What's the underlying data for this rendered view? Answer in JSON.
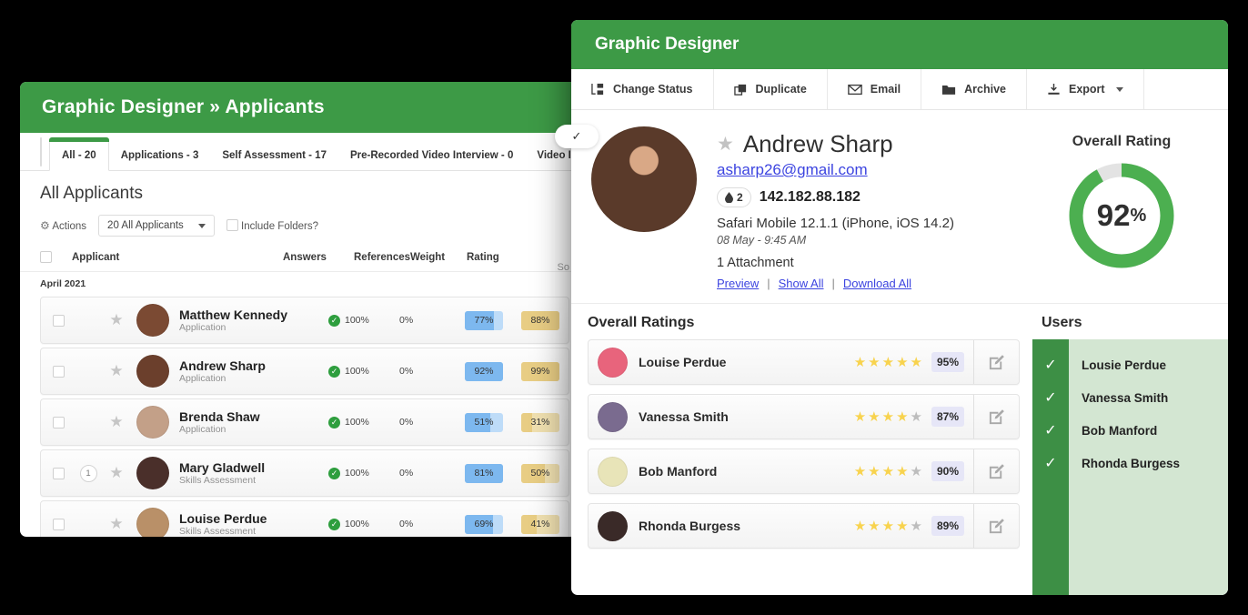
{
  "back_panel": {
    "header_title": "Graphic Designer » Applicants",
    "tabs": [
      {
        "label": "All - 20",
        "active": true
      },
      {
        "label": "Applications - 3",
        "active": false
      },
      {
        "label": "Self Assessment - 17",
        "active": false
      },
      {
        "label": "Pre-Recorded Video Interview - 0",
        "active": false
      },
      {
        "label": "Video Interview Complete",
        "active": false
      }
    ],
    "subtitle": "All Applicants",
    "sort_label": "So",
    "actions_label": "Actions",
    "filter_select": "20 All Applicants",
    "include_folders_label": "Include Folders?",
    "columns": [
      "Applicant",
      "Answers",
      "References",
      "Weight",
      "Rating"
    ],
    "month_group": "April 2021",
    "rows": [
      {
        "name": "Matthew Kennedy",
        "stage": "Application",
        "answers": "100%",
        "references": "0%",
        "weight": "77%",
        "weight_fill": 77,
        "rating": "88%",
        "rating_fill": 100,
        "count": "",
        "avatar": "#7b4a33"
      },
      {
        "name": "Andrew Sharp",
        "stage": "Application",
        "answers": "100%",
        "references": "0%",
        "weight": "92%",
        "weight_fill": 100,
        "rating": "99%",
        "rating_fill": 100,
        "count": "",
        "avatar": "#6b3f2c"
      },
      {
        "name": "Brenda Shaw",
        "stage": "Application",
        "answers": "100%",
        "references": "0%",
        "weight": "51%",
        "weight_fill": 66,
        "rating": "31%",
        "rating_fill": 28,
        "count": "",
        "avatar": "#c3a088"
      },
      {
        "name": "Mary Gladwell",
        "stage": "Skills Assessment",
        "answers": "100%",
        "references": "0%",
        "weight": "81%",
        "weight_fill": 100,
        "rating": "50%",
        "rating_fill": 62,
        "count": "1",
        "avatar": "#4a2f2a"
      },
      {
        "name": "Louise Perdue",
        "stage": "Skills Assessment",
        "answers": "100%",
        "references": "0%",
        "weight": "69%",
        "weight_fill": 73,
        "rating": "41%",
        "rating_fill": 40,
        "count": "",
        "avatar": "#b99068"
      }
    ]
  },
  "front_panel": {
    "header_title": "Graphic Designer",
    "toolbar": [
      {
        "label": "Change Status",
        "icon": "change-status-icon"
      },
      {
        "label": "Duplicate",
        "icon": "duplicate-icon"
      },
      {
        "label": "Email",
        "icon": "envelope-icon"
      },
      {
        "label": "Archive",
        "icon": "folder-icon"
      },
      {
        "label": "Export",
        "icon": "download-icon",
        "dropdown": true
      }
    ],
    "candidate": {
      "name": "Andrew Sharp",
      "email": "asharp26@gmail.com",
      "drop_count": "2",
      "ip": "142.182.88.182",
      "user_agent": "Safari Mobile 12.1.1 (iPhone, iOS 14.2)",
      "timestamp": "08 May - 9:45 AM",
      "attachments": "1 Attachment",
      "links": [
        "Preview",
        "Show All",
        "Download All"
      ],
      "link_sep": "|"
    },
    "gauge": {
      "label": "Overall Rating",
      "value": 92,
      "value_text": "92",
      "suffix": "%",
      "color": "#4caf50",
      "track": "#e3e3e3"
    },
    "ratings_section_title": "Overall Ratings",
    "ratings": [
      {
        "name": "Louise Perdue",
        "stars": 5,
        "percent": "95%",
        "avatar": "#e8647c"
      },
      {
        "name": "Vanessa Smith",
        "stars": 4,
        "percent": "87%",
        "avatar": "#7a6b8f"
      },
      {
        "name": "Bob Manford",
        "stars": 4,
        "percent": "90%",
        "avatar": "#e8e4b8"
      },
      {
        "name": "Rhonda Burgess",
        "stars": 4,
        "percent": "89%",
        "avatar": "#3a2a28"
      }
    ],
    "users_section_title": "Users",
    "users": [
      {
        "name": "Lousie Perdue",
        "checked": true
      },
      {
        "name": "Vanessa Smith",
        "checked": true
      },
      {
        "name": "Bob Manford",
        "checked": true
      },
      {
        "name": "Rhonda Burgess",
        "checked": true
      }
    ],
    "accent_green": "#3d9a46"
  }
}
